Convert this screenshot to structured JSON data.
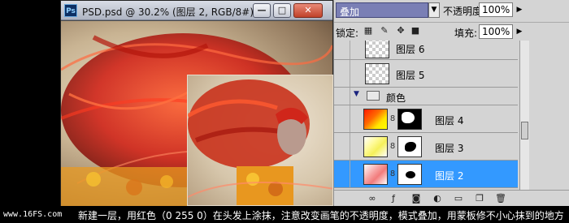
{
  "document": {
    "app_badge": "Ps",
    "title": "PSD.psd @ 30.2% (图层 2, RGB/8#) *",
    "buttons": {
      "minimize": "—",
      "maximize": "□",
      "close": "✕"
    }
  },
  "layers_panel": {
    "blend_mode": "叠加",
    "opacity_label": "不透明度:",
    "opacity_value": "100%",
    "lock_label": "锁定:",
    "fill_label": "填充:",
    "fill_value": "100%",
    "layers": [
      {
        "name": "图层 6"
      },
      {
        "name": "图层 5"
      },
      {
        "name": "颜色"
      },
      {
        "name": "图层 4"
      },
      {
        "name": "图层 3"
      },
      {
        "name": "图层 2"
      }
    ]
  },
  "caption": {
    "watermark": "www.16FS.com",
    "text": "新建一层，用红色（0  255  0）在头发上涂抹，注意改变画笔的不透明度，模式叠加，用蒙板修不小心抹到的地方"
  },
  "colors": {
    "selected_layer": "#3399ff",
    "blend_select": "#7a7fb5",
    "hair_red": "#e0231a"
  }
}
